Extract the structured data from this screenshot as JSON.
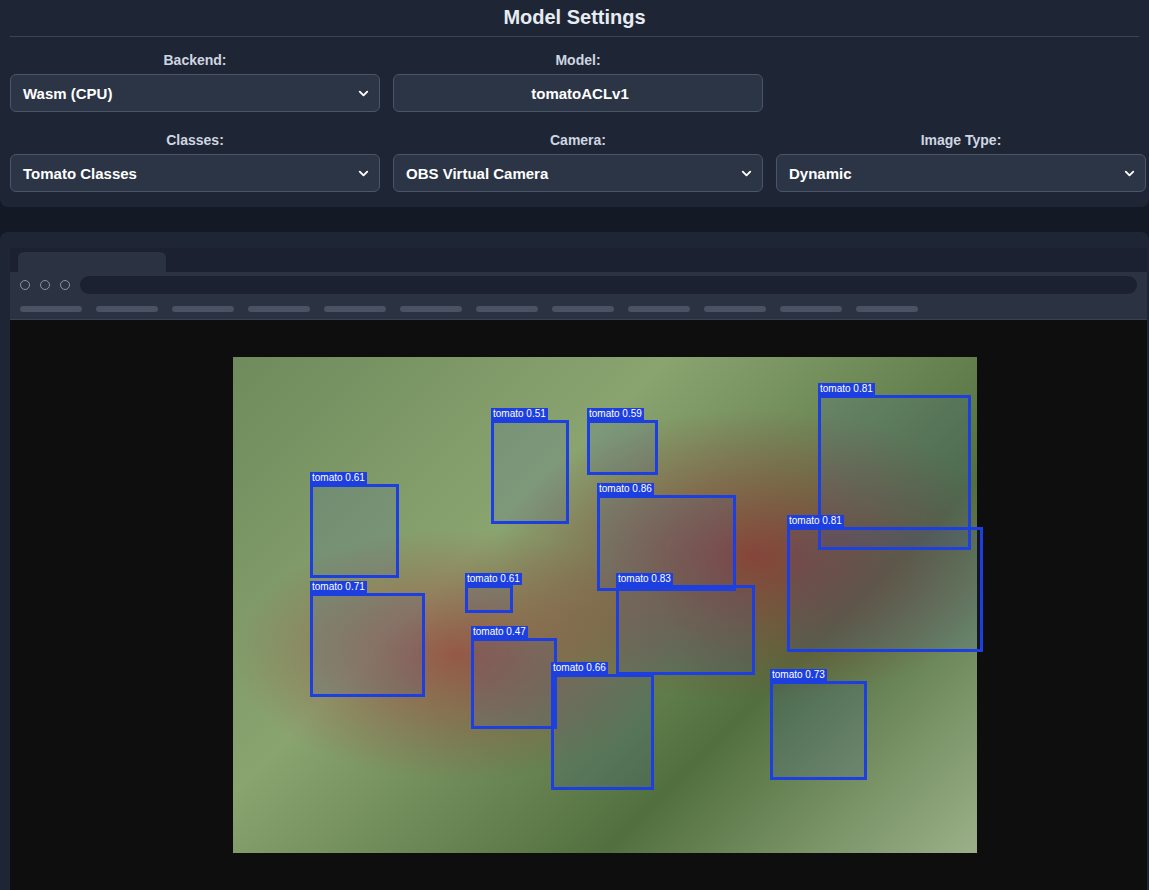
{
  "panel": {
    "title": "Model Settings"
  },
  "rows": [
    [
      {
        "label": "Backend:",
        "kind": "select",
        "value": "Wasm (CPU)"
      },
      {
        "label": "Model:",
        "kind": "input",
        "value": "tomatoACLv1"
      }
    ],
    [
      {
        "label": "Classes:",
        "kind": "select",
        "value": "Tomato Classes"
      },
      {
        "label": "Camera:",
        "kind": "select",
        "value": "OBS Virtual Camera"
      },
      {
        "label": "Image Type:",
        "kind": "select",
        "value": "Dynamic"
      }
    ]
  ],
  "detections": [
    {
      "label": "tomato 0.51"
    },
    {
      "label": "tomato 0.59"
    },
    {
      "label": "tomato 0.81"
    },
    {
      "label": "tomato 0.61"
    },
    {
      "label": "tomato 0.86"
    },
    {
      "label": "tomato 0.81"
    },
    {
      "label": "tomato 0.71"
    },
    {
      "label": "tomato 0.61"
    },
    {
      "label": "tomato 0.83"
    },
    {
      "label": "tomato 0.47"
    },
    {
      "label": "tomato 0.66"
    },
    {
      "label": "tomato 0.73"
    }
  ]
}
